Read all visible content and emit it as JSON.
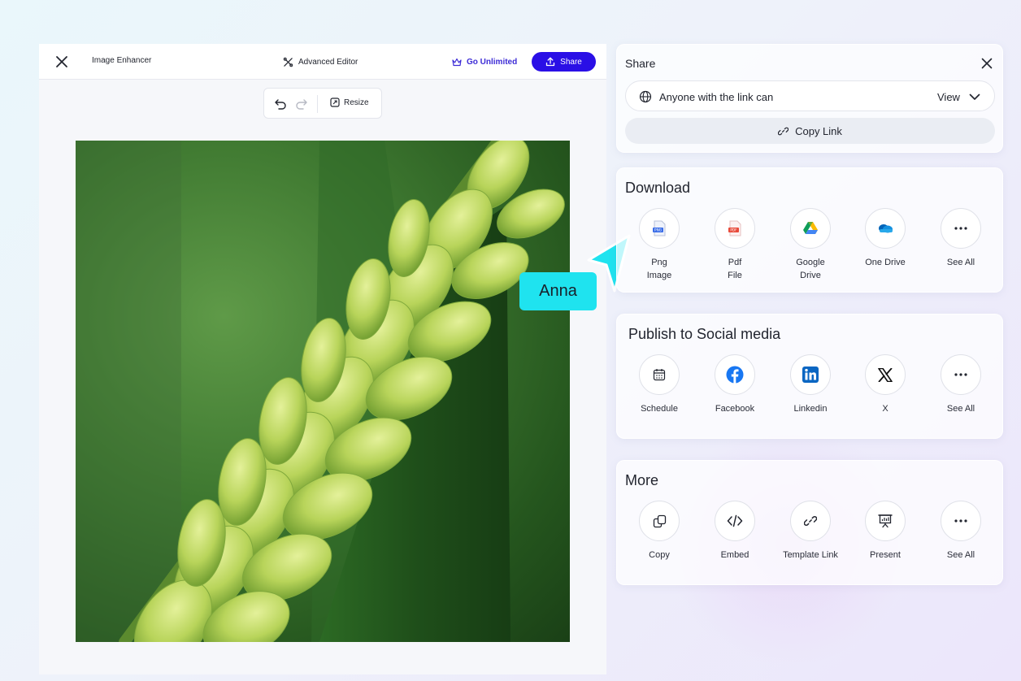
{
  "editor": {
    "app_name": "Image Enhancer",
    "advanced_editor_label": "Advanced Editor",
    "go_unlimited_label": "Go Unlimited",
    "share_button_label": "Share",
    "toolbar": {
      "resize_label": "Resize"
    }
  },
  "collaborator": {
    "name": "Anna",
    "color": "#1fe3ef"
  },
  "share_panel": {
    "title": "Share",
    "access_text": "Anyone with the link can",
    "access_value": "View",
    "copy_link_label": "Copy Link"
  },
  "download": {
    "title": "Download",
    "items": [
      {
        "label": "Png\nImage",
        "icon": "png-file-icon"
      },
      {
        "label": "Pdf\nFile",
        "icon": "pdf-file-icon"
      },
      {
        "label": "Google\nDrive",
        "icon": "google-drive-icon"
      },
      {
        "label": "One Drive",
        "icon": "onedrive-icon"
      },
      {
        "label": "See All",
        "icon": "more-dots-icon"
      }
    ]
  },
  "social": {
    "title": "Publish to Social media",
    "items": [
      {
        "label": "Schedule",
        "icon": "calendar-icon"
      },
      {
        "label": "Facebook",
        "icon": "facebook-icon"
      },
      {
        "label": "Linkedin",
        "icon": "linkedin-icon"
      },
      {
        "label": "X",
        "icon": "x-logo-icon"
      },
      {
        "label": "See All",
        "icon": "more-dots-icon"
      }
    ]
  },
  "more": {
    "title": "More",
    "items": [
      {
        "label": "Copy",
        "icon": "copy-icon"
      },
      {
        "label": "Embed",
        "icon": "embed-code-icon"
      },
      {
        "label": "Template Link",
        "icon": "link-icon"
      },
      {
        "label": "Present",
        "icon": "presentation-icon"
      },
      {
        "label": "See All",
        "icon": "more-dots-icon"
      }
    ]
  },
  "colors": {
    "primary": "#2a0fe6",
    "accent_text": "#3c2bd6",
    "cursor": "#1fe3ef"
  }
}
